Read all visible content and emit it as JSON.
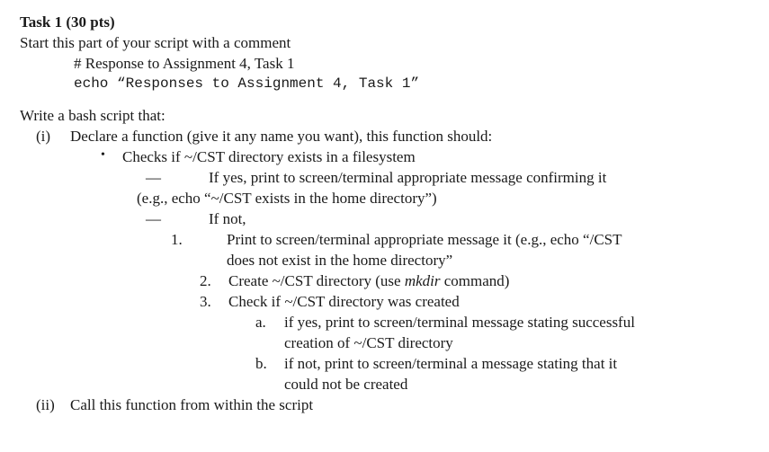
{
  "title_bold": "Task 1 (30 pts)",
  "intro": "Start this part of your script with a comment",
  "comment_line": "# Response to Assignment 4, Task 1",
  "echo_line": "echo “Responses to Assignment 4, Task 1”",
  "write_line": "Write a bash script that:",
  "item_i": {
    "marker": "(i)",
    "text": "Declare a function (give it any name you want), this function should:"
  },
  "bullet": {
    "marker": "•",
    "text": "Checks if ~/CST directory exists in a filesystem"
  },
  "dash1": {
    "marker": "—",
    "line1": "If yes, print to screen/terminal appropriate message confirming it",
    "line2": "(e.g., echo “~/CST exists in the home directory”)"
  },
  "dash2": {
    "marker": "—",
    "text": "If not,"
  },
  "num1": {
    "marker": "1.",
    "line1": "Print to screen/terminal appropriate message it (e.g., echo “/CST",
    "line2": "does not exist in the home directory”"
  },
  "num2": {
    "marker": "2.",
    "pre": "Create ~/CST directory (use ",
    "ital": "mkdir",
    "post": " command)"
  },
  "num3": {
    "marker": "3.",
    "text": "Check if ~/CST directory was created"
  },
  "alpha_a": {
    "marker": "a.",
    "line1": "if yes, print to screen/terminal message stating successful",
    "line2": "creation of ~/CST directory"
  },
  "alpha_b": {
    "marker": "b.",
    "line1": "if not, print to screen/terminal a message stating that it",
    "line2": "could not be created"
  },
  "item_ii": {
    "marker": "(ii)",
    "text": "Call this function from within the script"
  }
}
